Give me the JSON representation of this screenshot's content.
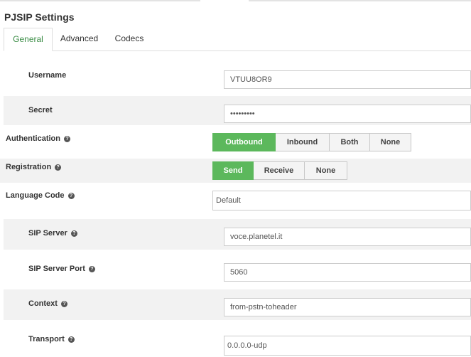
{
  "title": "PJSIP Settings",
  "tabs": [
    {
      "label": "General"
    },
    {
      "label": "Advanced"
    },
    {
      "label": "Codecs"
    }
  ],
  "active_tab": "General",
  "help_glyph": "?",
  "fields": {
    "username": {
      "label": "Username",
      "value": "VTUU8OR9"
    },
    "secret": {
      "label": "Secret",
      "value": "•••••••••"
    },
    "authentication": {
      "label": "Authentication",
      "options": [
        "Outbound",
        "Inbound",
        "Both",
        "None"
      ],
      "selected": "Outbound"
    },
    "registration": {
      "label": "Registration",
      "options": [
        "Send",
        "Receive",
        "None"
      ],
      "selected": "Send"
    },
    "language_code": {
      "label": "Language Code",
      "value": "Default"
    },
    "sip_server": {
      "label": "SIP Server",
      "value": "voce.planetel.it"
    },
    "sip_server_port": {
      "label": "SIP Server Port",
      "value": "5060"
    },
    "context": {
      "label": "Context",
      "value": "from-pstn-toheader"
    },
    "transport": {
      "label": "Transport",
      "value": "0.0.0.0-udp"
    }
  },
  "colors": {
    "selected_button": "#5cb85c",
    "row_shade": "#f2f2f2",
    "active_tab_text": "#3a8c45"
  }
}
